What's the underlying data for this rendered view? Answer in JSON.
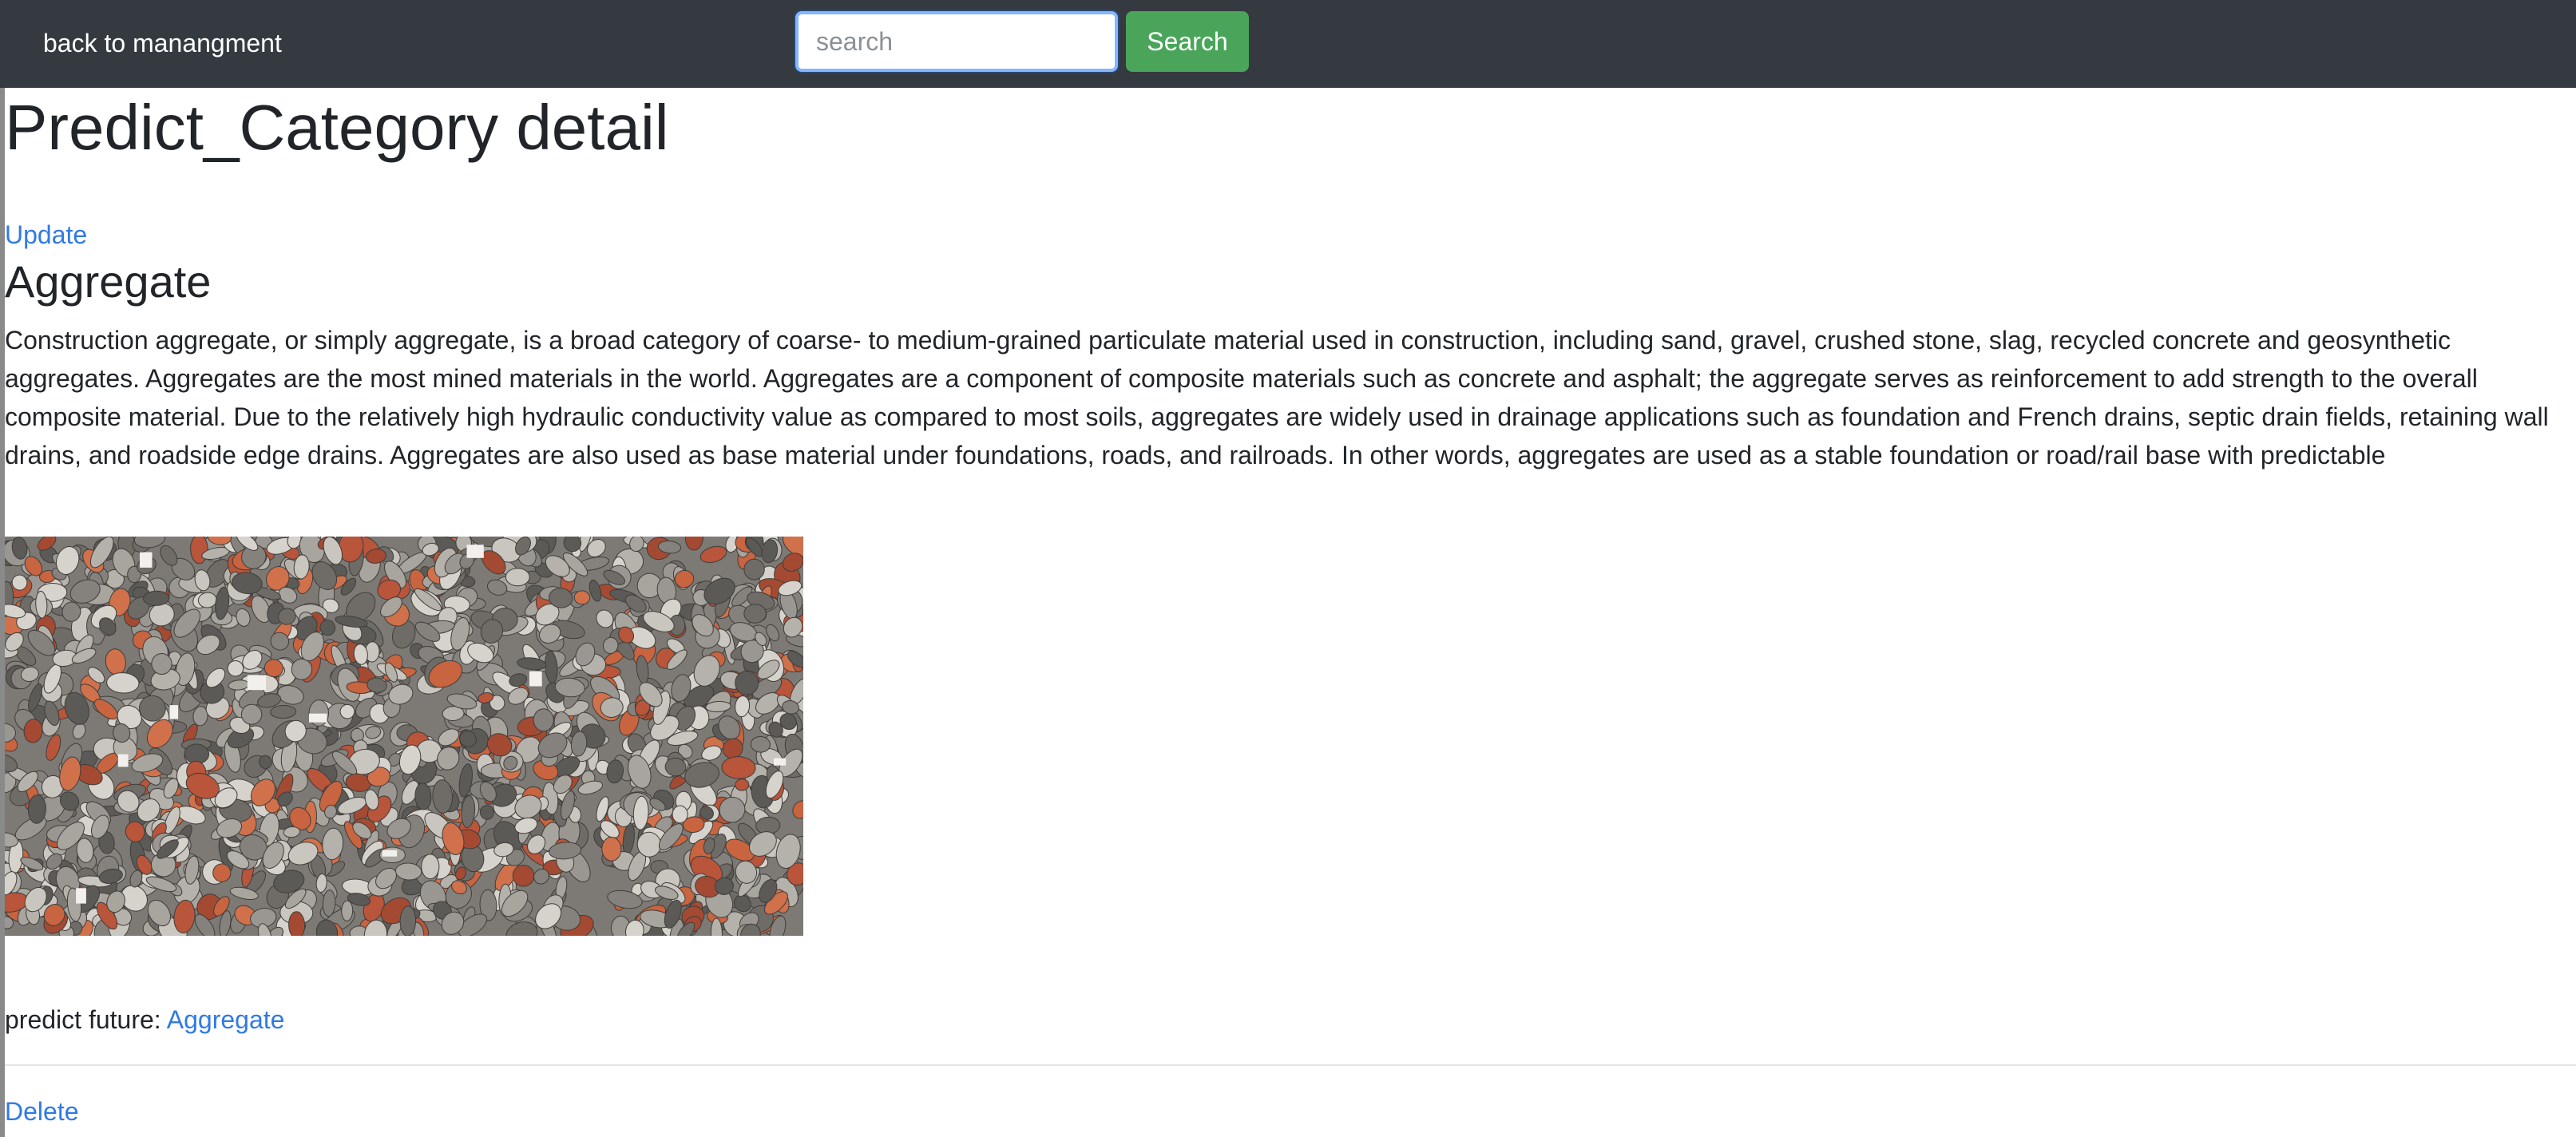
{
  "navbar": {
    "back_label": "back to manangment",
    "search_placeholder": "search",
    "search_button": "Search"
  },
  "page": {
    "title": "Predict_Category detail",
    "update_link": "Update",
    "category_name": "Aggregate",
    "description": "Construction aggregate, or simply aggregate, is a broad category of coarse- to medium-grained particulate material used in construction, including sand, gravel, crushed stone, slag, recycled concrete and geosynthetic aggregates. Aggregates are the most mined materials in the world. Aggregates are a component of composite materials such as concrete and asphalt; the aggregate serves as reinforcement to add strength to the overall composite material. Due to the relatively high hydraulic conductivity value as compared to most soils, aggregates are widely used in drainage applications such as foundation and French drains, septic drain fields, retaining wall drains, and roadside edge drains. Aggregates are also used as base material under foundations, roads, and railroads. In other words, aggregates are used as a stable foundation or road/rail base with predictable",
    "predict_label": "predict future:",
    "predict_link": "Aggregate",
    "delete_link": "Delete"
  },
  "colors": {
    "navbar_bg": "#343a40",
    "link": "#2f7ae5",
    "search_button_bg": "#4aa55a"
  }
}
